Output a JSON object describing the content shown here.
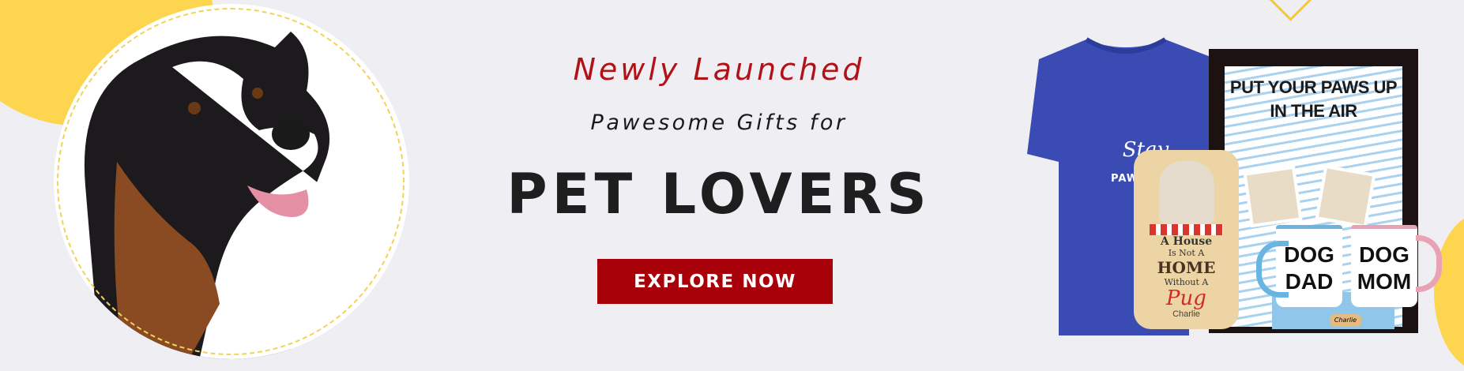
{
  "banner": {
    "eyebrow": "Newly Launched",
    "subtitle": "Pawesome Gifts for",
    "title": "PET LOVERS",
    "cta_label": "EXPLORE NOW",
    "colors": {
      "background": "#eeeef3",
      "accent": "#a70008",
      "yellow": "#fdd54f",
      "shirt": "#3a4cb4"
    }
  },
  "products": {
    "tshirt": {
      "line1": "Stay",
      "line2": "PAWSITIVE"
    },
    "frame": {
      "text": "PUT YOUR PAWS UP IN THE AIR"
    },
    "plaque": {
      "line1": "A House",
      "line2": "Is Not A",
      "line3": "HOME",
      "line4": "Without A",
      "line5": "Pug",
      "name": "Charlie"
    },
    "mug_dad": {
      "line1": "DOG",
      "line2": "DAD"
    },
    "mug_mom": {
      "line1": "DOG",
      "line2": "MOM"
    },
    "keychain": {
      "name": "Charlie"
    }
  }
}
